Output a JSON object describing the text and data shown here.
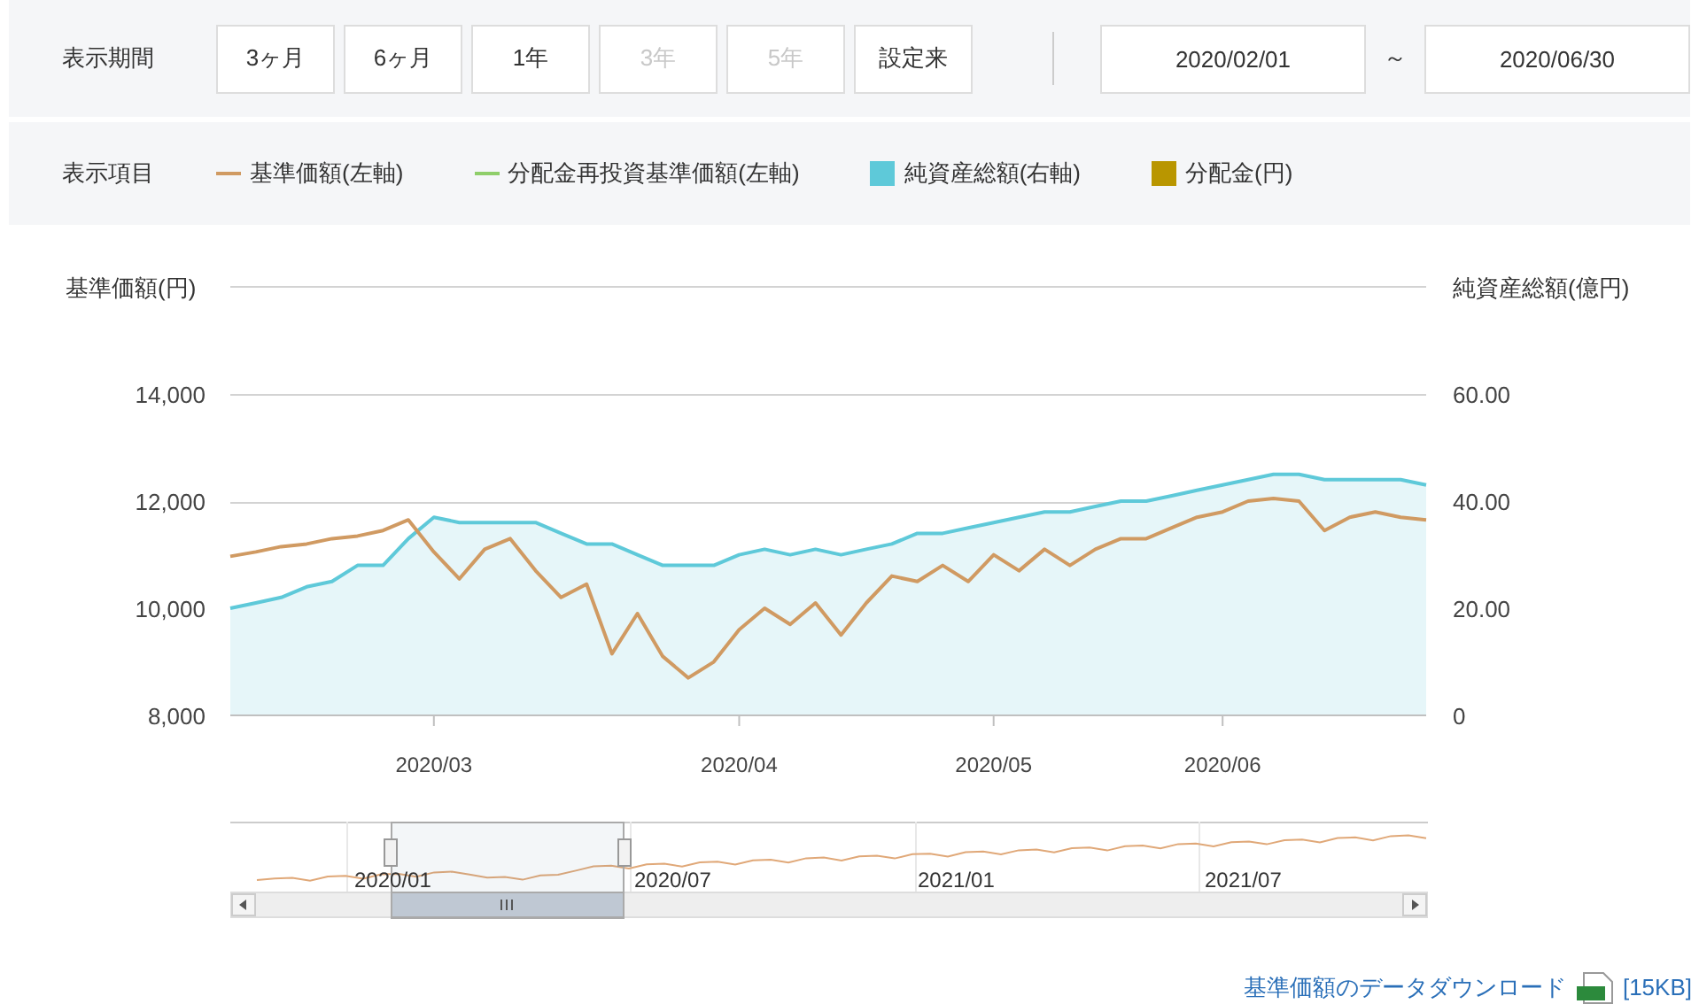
{
  "period": {
    "label": "表示期間",
    "buttons": [
      {
        "label": "3ヶ月",
        "disabled": false
      },
      {
        "label": "6ヶ月",
        "disabled": false
      },
      {
        "label": "1年",
        "disabled": false
      },
      {
        "label": "3年",
        "disabled": true
      },
      {
        "label": "5年",
        "disabled": true
      },
      {
        "label": "設定来",
        "disabled": false
      }
    ],
    "from": "2020/02/01",
    "separator": "～",
    "to": "2020/06/30"
  },
  "legend": {
    "label": "表示項目",
    "items": [
      {
        "label": "基準価額(左軸)",
        "kind": "line",
        "color": "#d09a62"
      },
      {
        "label": "分配金再投資基準価額(左軸)",
        "kind": "line",
        "color": "#8fce6a"
      },
      {
        "label": "純資産総額(右軸)",
        "kind": "square",
        "color": "#5ec9d9"
      },
      {
        "label": "分配金(円)",
        "kind": "square",
        "color": "#b99600"
      }
    ]
  },
  "chart_data": {
    "type": "line",
    "ylabel": "基準価額(円)",
    "y2label": "純資産総額(億円)",
    "categories": [
      null,
      null,
      null,
      null,
      null,
      null,
      null,
      null,
      "2020/03",
      null,
      null,
      null,
      null,
      null,
      null,
      null,
      null,
      null,
      null,
      null,
      "2020/04",
      null,
      null,
      null,
      null,
      null,
      null,
      null,
      null,
      null,
      "2020/05",
      null,
      null,
      null,
      null,
      null,
      null,
      null,
      null,
      "2020/06",
      null,
      null,
      null,
      null,
      null,
      null,
      null,
      null
    ],
    "series": [
      {
        "color": "#5ec9d9",
        "axis": "y2",
        "values": [
          20,
          21,
          22,
          24,
          25,
          28,
          28,
          33,
          37,
          36,
          36,
          36,
          36,
          34,
          32,
          32,
          30,
          28,
          28,
          28,
          30,
          31,
          30,
          31,
          30,
          31,
          32,
          34,
          34,
          35,
          36,
          37,
          38,
          38,
          39,
          40,
          40,
          41,
          42,
          43,
          44,
          45,
          45,
          44,
          44,
          44,
          44,
          43
        ]
      },
      {
        "color": "#d09a62",
        "values": [
          10970,
          11050,
          11150,
          11200,
          11300,
          11350,
          11450,
          11650,
          11050,
          10550,
          11100,
          11300,
          10700,
          10200,
          10450,
          9150,
          9900,
          9100,
          8700,
          9000,
          9600,
          10000,
          9700,
          10100,
          9500,
          10100,
          10600,
          10500,
          10800,
          10500,
          11000,
          10700,
          11100,
          10800,
          11100,
          11300,
          11300,
          11500,
          11700,
          11800,
          12000,
          12050,
          12000,
          11450,
          11700,
          11800,
          11700,
          11650
        ]
      }
    ],
    "ylim": [
      8000,
      16000
    ],
    "yticks": [
      {
        "value": 8000,
        "label": "8,000"
      },
      {
        "value": 10000,
        "label": "10,000"
      },
      {
        "value": 12000,
        "label": "12,000"
      },
      {
        "value": 14000,
        "label": "14,000"
      }
    ],
    "y2lim": [
      0,
      80
    ],
    "y2ticks": [
      {
        "value": 0,
        "label": "0"
      },
      {
        "value": 20,
        "label": "20.00"
      },
      {
        "value": 40,
        "label": "40.00"
      },
      {
        "value": 60,
        "label": "60.00"
      }
    ]
  },
  "navigator": {
    "labels": [
      "2020/01",
      "2020/07",
      "2021/01",
      "2021/07"
    ]
  },
  "download": {
    "link": "基準価額のデータダウンロード",
    "size": "[15KB]"
  }
}
